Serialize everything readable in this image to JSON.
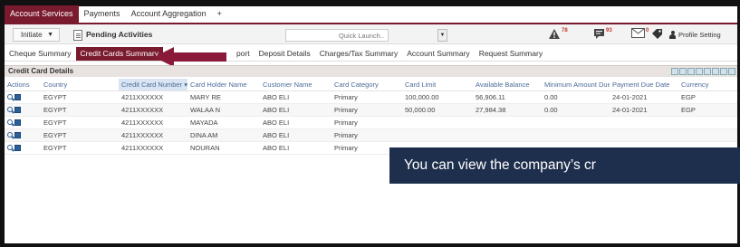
{
  "main_nav": {
    "items": [
      {
        "label": "Account Services",
        "active": true
      },
      {
        "label": "Payments",
        "active": false
      },
      {
        "label": "Account Aggregation",
        "active": false
      }
    ],
    "add_label": "+"
  },
  "toolbar": {
    "initiate_label": "Initiate",
    "pending_label": "Pending Activities",
    "quick_launch_placeholder": "Quick Launch..",
    "badges": {
      "alerts": "78",
      "messages": "93",
      "mail": "0"
    },
    "profile_label": "Profile Setting"
  },
  "sub_nav": {
    "items": [
      {
        "label": "Cheque Summary",
        "active": false
      },
      {
        "label": "Credit Cards Summary",
        "active": true
      },
      {
        "label": "N",
        "active": false
      },
      {
        "label": "port",
        "active": false
      },
      {
        "label": "Deposit Details",
        "active": false
      },
      {
        "label": "Charges/Tax Summary",
        "active": false
      },
      {
        "label": "Account Summary",
        "active": false
      },
      {
        "label": "Request Summary",
        "active": false
      }
    ]
  },
  "section": {
    "title": "Credit Card Details"
  },
  "table": {
    "columns": [
      "Actions",
      "Country",
      "Credit Card Number",
      "Card Holder Name",
      "Customer Name",
      "Card Category",
      "Card Limit",
      "Available Balance",
      "Minimum Amount Due",
      "Payment Due Date",
      "Currency"
    ],
    "sorted_column": "Credit Card Number",
    "rows": [
      {
        "country": "EGYPT",
        "card_number": "4211XXXXXX",
        "holder": "MARY RE",
        "customer": "ABO ELI",
        "category": "Primary",
        "limit": "100,000.00",
        "balance": "56,906.11",
        "min_due": "0.00",
        "due_date": "24-01-2021",
        "currency": "EGP"
      },
      {
        "country": "EGYPT",
        "card_number": "4211XXXXXX",
        "holder": "WALAA N",
        "customer": "ABO ELI",
        "category": "Primary",
        "limit": "50,000.00",
        "balance": "27,984.38",
        "min_due": "0.00",
        "due_date": "24-01-2021",
        "currency": "EGP"
      },
      {
        "country": "EGYPT",
        "card_number": "4211XXXXXX",
        "holder": "MAYADA",
        "customer": "ABO ELI",
        "category": "Primary",
        "limit": "",
        "balance": "",
        "min_due": "",
        "due_date": "",
        "currency": ""
      },
      {
        "country": "EGYPT",
        "card_number": "4211XXXXXX",
        "holder": "DINA AM",
        "customer": "ABO ELI",
        "category": "Primary",
        "limit": "",
        "balance": "",
        "min_due": "",
        "due_date": "",
        "currency": ""
      },
      {
        "country": "EGYPT",
        "card_number": "4211XXXXXX",
        "holder": "NOURAN",
        "customer": "ABO ELI",
        "category": "Primary",
        "limit": "",
        "balance": "",
        "min_due": "",
        "due_date": "",
        "currency": ""
      }
    ]
  },
  "callout": {
    "text": "You can view the company’s cr"
  },
  "colors": {
    "brand": "#7a1a2e",
    "callout_bg": "#1e2f4d",
    "header_text": "#4a6b98"
  }
}
